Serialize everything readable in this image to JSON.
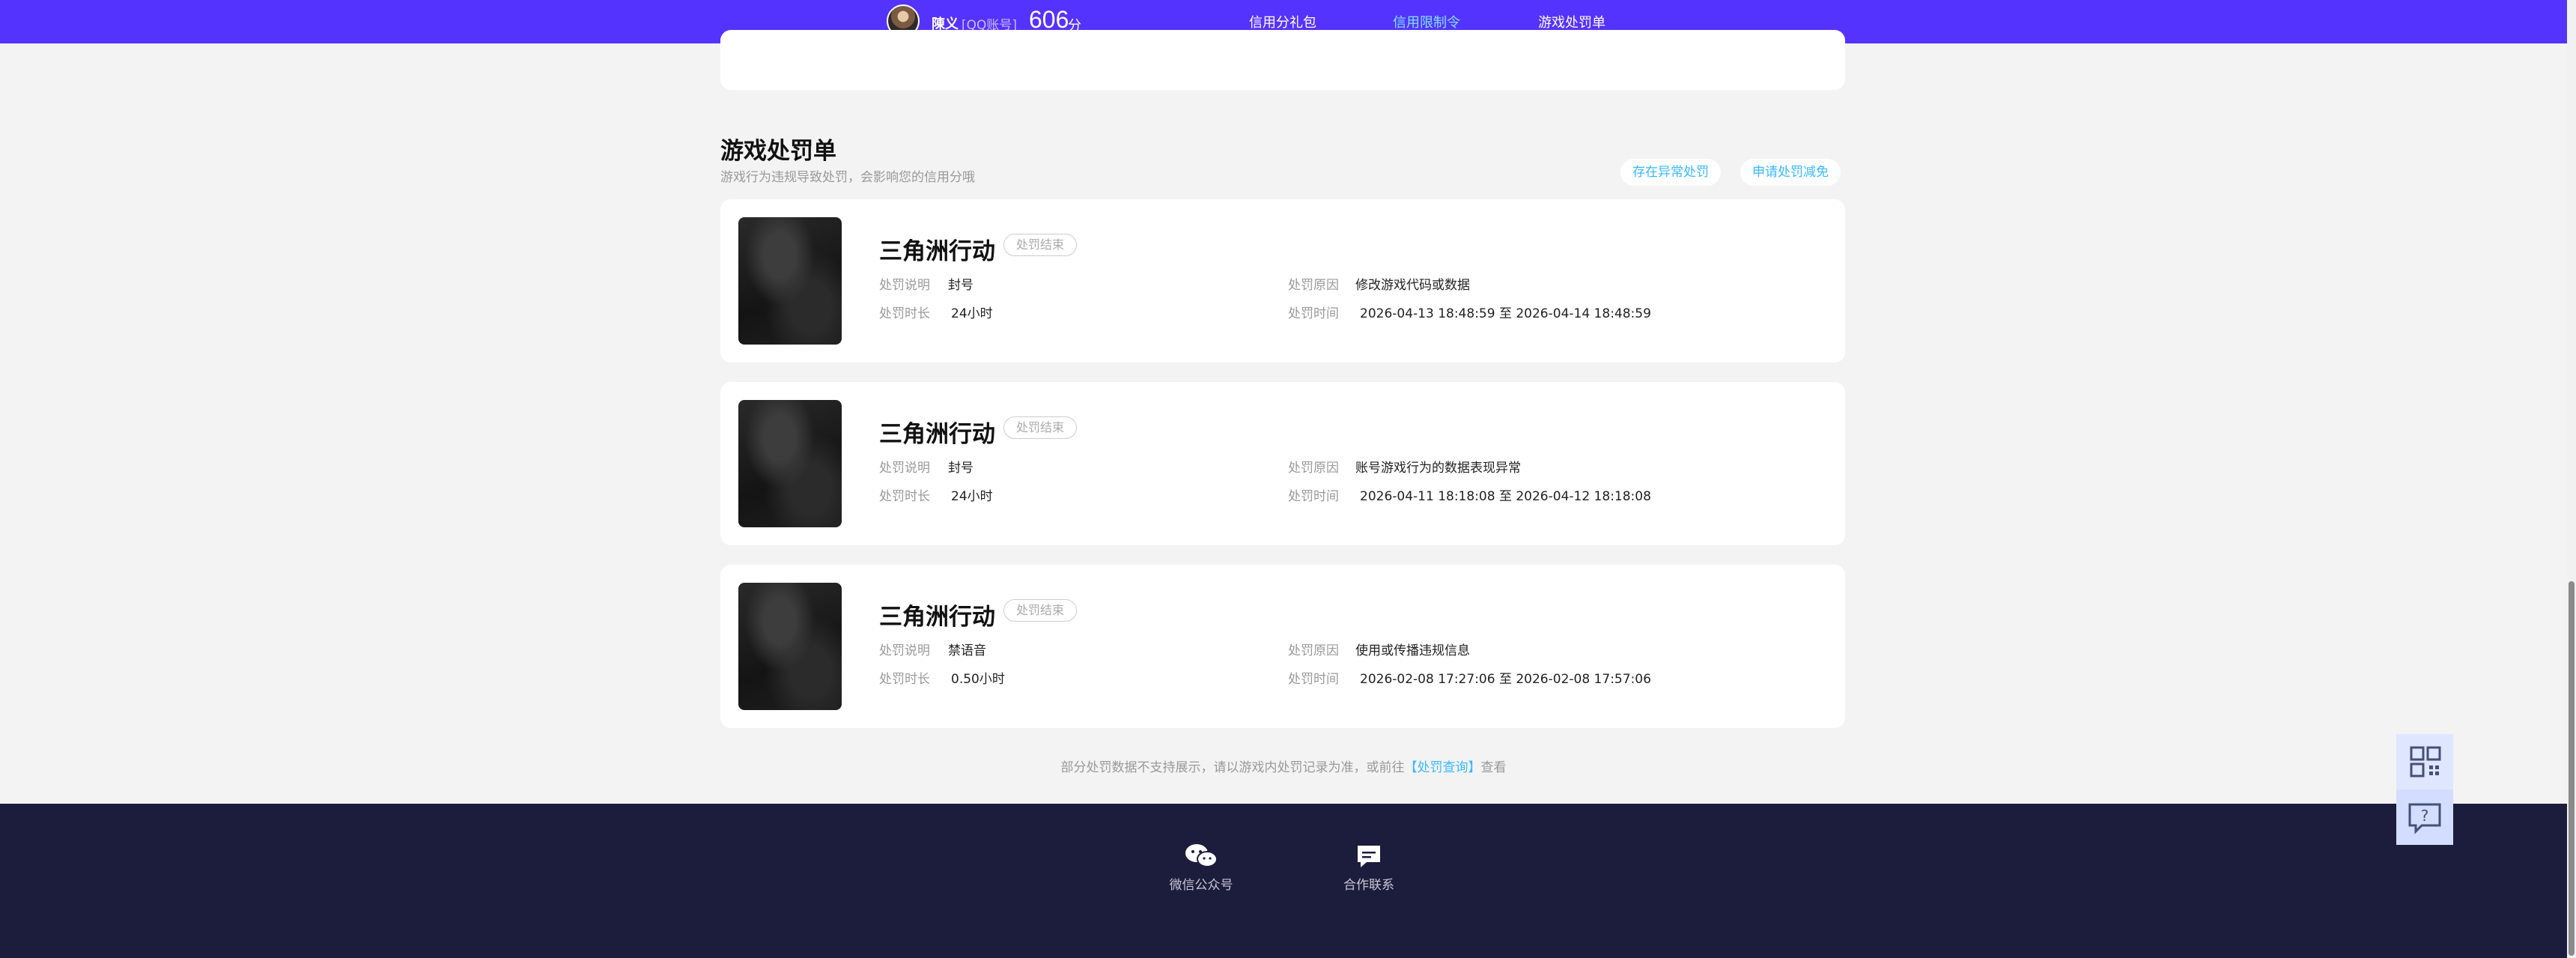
{
  "header": {
    "username": "陳义",
    "account_type": "[QQ账号]",
    "score": "606",
    "score_unit": "分",
    "nav": [
      {
        "label": "信用分礼包",
        "active": false
      },
      {
        "label": "信用限制令",
        "active": true
      },
      {
        "label": "游戏处罚单",
        "active": false
      }
    ]
  },
  "section": {
    "title": "游戏处罚单",
    "subtitle": "游戏行为违规导致处罚，会影响您的信用分哦",
    "actions": [
      "存在异常处罚",
      "申请处罚减免"
    ]
  },
  "penalties": [
    {
      "game": "三角洲行动",
      "status": "处罚结束",
      "desc_label": "处罚说明",
      "desc": "封号",
      "dur_label": "处罚时长",
      "duration": "24小时",
      "reason_label": "处罚原因",
      "reason": "修改游戏代码或数据",
      "time_label": "处罚时间",
      "time": "2026-04-13 18:48:59 至 2026-04-14 18:48:59"
    },
    {
      "game": "三角洲行动",
      "status": "处罚结束",
      "desc_label": "处罚说明",
      "desc": "封号",
      "dur_label": "处罚时长",
      "duration": "24小时",
      "reason_label": "处罚原因",
      "reason": "账号游戏行为的数据表现异常",
      "time_label": "处罚时间",
      "time": "2026-04-11 18:18:08 至 2026-04-12 18:18:08"
    },
    {
      "game": "三角洲行动",
      "status": "处罚结束",
      "desc_label": "处罚说明",
      "desc": "禁语音",
      "dur_label": "处罚时长",
      "duration": "0.50小时",
      "reason_label": "处罚原因",
      "reason": "使用或传播违规信息",
      "time_label": "处罚时间",
      "time": "2026-02-08 17:27:06 至 2026-02-08 17:57:06"
    }
  ],
  "note": {
    "prefix": "部分处罚数据不支持展示，请以游戏内处罚记录为准，或前往",
    "link": "【处罚查询】",
    "suffix": "查看"
  },
  "footer": {
    "items": [
      {
        "label": "微信公众号",
        "icon": "wechat-icon"
      },
      {
        "label": "合作联系",
        "icon": "chat-bubble-icon"
      }
    ]
  },
  "floats": [
    {
      "icon": "qrcode-icon"
    },
    {
      "icon": "help-icon",
      "label": "?"
    }
  ],
  "colors": {
    "header_bg": "#5533ff",
    "accent": "#3ab8ff",
    "active_nav": "#7fe3ff",
    "footer_bg": "#1c1d3c"
  }
}
